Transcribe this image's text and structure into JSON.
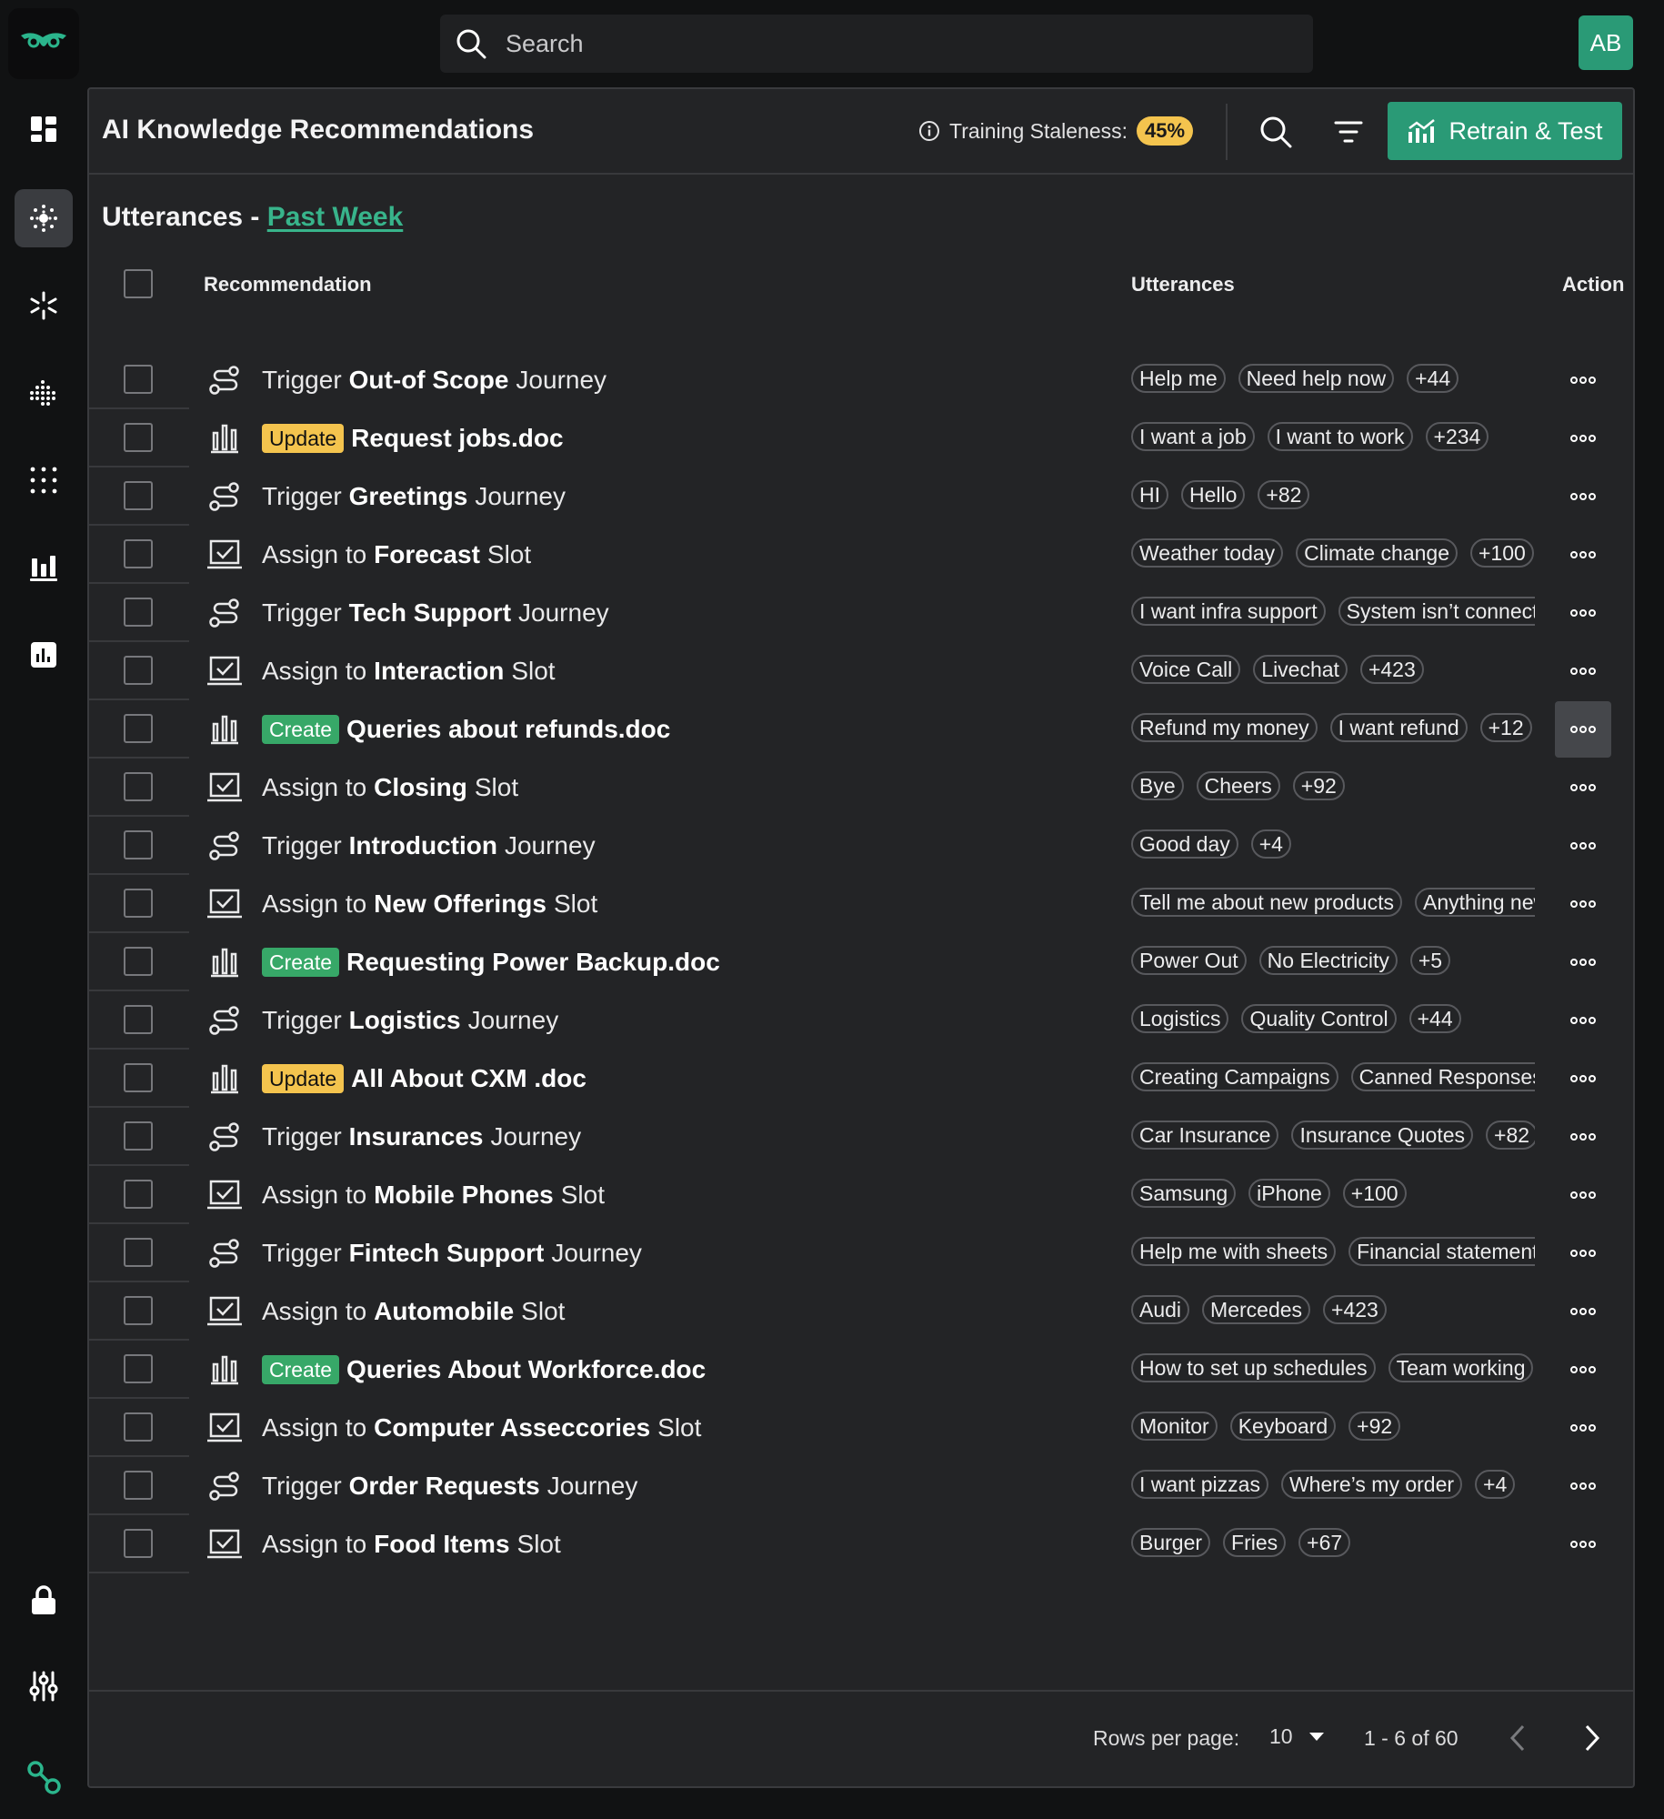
{
  "search": {
    "placeholder": "Search"
  },
  "user": {
    "initials": "AB"
  },
  "header": {
    "title": "AI Knowledge Recommendations",
    "staleness_label": "Training Staleness:",
    "staleness_value": "45%",
    "retrain_label": "Retrain & Test"
  },
  "section": {
    "title": "Utterances - ",
    "range": "Past Week"
  },
  "columns": {
    "recommendation": "Recommendation",
    "utterances": "Utterances",
    "action": "Action"
  },
  "rows": [
    {
      "type": "journey",
      "prefix": "Trigger",
      "tag": "",
      "name": "Out-of Scope",
      "suffix": "Journey",
      "chips": [
        "Help me",
        "Need help now",
        "+44"
      ]
    },
    {
      "type": "doc",
      "prefix": "",
      "tag": "Update",
      "name": "Request jobs.doc",
      "suffix": "",
      "chips": [
        "I want a job",
        "I want to work",
        "+234"
      ]
    },
    {
      "type": "journey",
      "prefix": "Trigger",
      "tag": "",
      "name": "Greetings",
      "suffix": "Journey",
      "chips": [
        "HI",
        "Hello",
        "+82"
      ]
    },
    {
      "type": "slot",
      "prefix": "Assign to",
      "tag": "",
      "name": "Forecast",
      "suffix": "Slot",
      "chips": [
        "Weather today",
        "Climate change",
        "+100"
      ]
    },
    {
      "type": "journey",
      "prefix": "Trigger",
      "tag": "",
      "name": "Tech Support",
      "suffix": "Journey",
      "chips": [
        "I want infra support",
        "System isn’t connecting"
      ]
    },
    {
      "type": "slot",
      "prefix": "Assign to",
      "tag": "",
      "name": "Interaction",
      "suffix": "Slot",
      "chips": [
        "Voice Call",
        "Livechat",
        "+423"
      ]
    },
    {
      "type": "doc",
      "prefix": "",
      "tag": "Create",
      "name": "Queries about refunds.doc",
      "suffix": "",
      "chips": [
        "Refund my money",
        "I want refund",
        "+12"
      ]
    },
    {
      "type": "slot",
      "prefix": "Assign to",
      "tag": "",
      "name": "Closing",
      "suffix": "Slot",
      "chips": [
        "Bye",
        "Cheers",
        "+92"
      ]
    },
    {
      "type": "journey",
      "prefix": "Trigger",
      "tag": "",
      "name": "Introduction",
      "suffix": "Journey",
      "chips": [
        "Good day",
        "+4"
      ]
    },
    {
      "type": "slot",
      "prefix": "Assign to",
      "tag": "",
      "name": "New Offerings",
      "suffix": "Slot",
      "chips": [
        "Tell me about new products",
        "Anything new"
      ]
    },
    {
      "type": "doc",
      "prefix": "",
      "tag": "Create",
      "name": "Requesting Power Backup.doc",
      "suffix": "",
      "chips": [
        "Power Out",
        "No Electricity",
        "+5"
      ]
    },
    {
      "type": "journey",
      "prefix": "Trigger",
      "tag": "",
      "name": "Logistics",
      "suffix": "Journey",
      "chips": [
        "Logistics",
        "Quality Control",
        "+44"
      ]
    },
    {
      "type": "doc",
      "prefix": "",
      "tag": "Update",
      "name": "All About CXM .doc",
      "suffix": "",
      "chips": [
        "Creating Campaigns",
        "Canned Responses"
      ]
    },
    {
      "type": "journey",
      "prefix": "Trigger",
      "tag": "",
      "name": "Insurances",
      "suffix": "Journey",
      "chips": [
        "Car Insurance",
        "Insurance Quotes",
        "+82"
      ]
    },
    {
      "type": "slot",
      "prefix": "Assign to",
      "tag": "",
      "name": "Mobile Phones",
      "suffix": "Slot",
      "chips": [
        "Samsung",
        "iPhone",
        "+100"
      ]
    },
    {
      "type": "journey",
      "prefix": "Trigger",
      "tag": "",
      "name": "Fintech Support",
      "suffix": "Journey",
      "chips": [
        "Help me with sheets",
        "Financial statements"
      ]
    },
    {
      "type": "slot",
      "prefix": "Assign to",
      "tag": "",
      "name": "Automobile",
      "suffix": "Slot",
      "chips": [
        "Audi",
        "Mercedes",
        "+423"
      ]
    },
    {
      "type": "doc",
      "prefix": "",
      "tag": "Create",
      "name": "Queries About Workforce.doc",
      "suffix": "",
      "chips": [
        "How to set up schedules",
        "Team working"
      ]
    },
    {
      "type": "slot",
      "prefix": "Assign to",
      "tag": "",
      "name": "Computer Asseccories",
      "suffix": "Slot",
      "chips": [
        "Monitor",
        "Keyboard",
        "+92"
      ]
    },
    {
      "type": "journey",
      "prefix": "Trigger",
      "tag": "",
      "name": "Order Requests",
      "suffix": "Journey",
      "chips": [
        "I want pizzas",
        "Where’s my order",
        "+4"
      ]
    },
    {
      "type": "slot",
      "prefix": "Assign to",
      "tag": "",
      "name": "Food Items",
      "suffix": "Slot",
      "chips": [
        "Burger",
        "Fries",
        "+67"
      ]
    }
  ],
  "active_action_row": 6,
  "pagination": {
    "rows_per_page_label": "Rows per page:",
    "rows_per_page": "10",
    "range": "1 - 6 of 60"
  },
  "colors": {
    "accent": "#2a9a76",
    "link": "#38b48b",
    "update": "#f4c44e",
    "create": "#37a868"
  },
  "icons": {
    "sidebar": [
      "dashboard-icon",
      "ai-hub-icon",
      "sparkle-icon",
      "dots-wave-icon",
      "dots-grid-icon",
      "bar-chart-icon",
      "report-icon",
      "lock-icon",
      "sliders-icon",
      "connect-icon"
    ],
    "row_types": {
      "journey": "journey-icon",
      "doc": "document-chart-icon",
      "slot": "slot-check-icon"
    }
  }
}
